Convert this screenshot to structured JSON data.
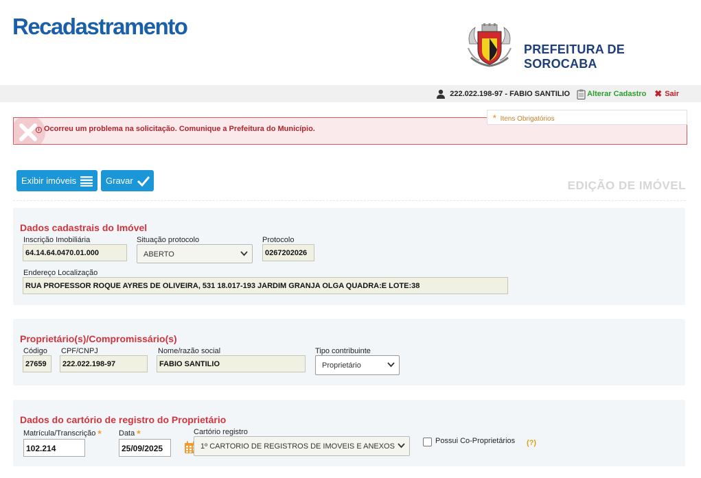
{
  "header": {
    "app_title": "Recadastramento",
    "city_name": "PREFEITURA DE SOROCABA"
  },
  "topbar": {
    "user": "222.022.198-97 - FABIO SANTILIO",
    "alter_label": "Alterar Cadastro",
    "exit_label": "Sair"
  },
  "required_note": "Itens Obrigatórios",
  "error": {
    "message": "Ocorreu um problema na solicitação. Comunique a Prefeitura do Município."
  },
  "toolbar": {
    "list_label": "Exibir imóveis",
    "save_label": "Gravar"
  },
  "page_title": "EDIÇÃO DE IMÓVEL",
  "property": {
    "title": "Dados cadastrais do Imóvel",
    "registration_label": "Inscrição Imobiliária",
    "registration_value": "64.14.64.0470.01.000",
    "status_label": "Situação protocolo",
    "status_value": "ABERTO",
    "protocol_label": "Protocolo",
    "protocol_value": "0267202026",
    "address_label": "Endereço Localização",
    "address_value": "RUA PROFESSOR ROQUE AYRES DE OLIVEIRA, 531 18.017-193 JARDIM GRANJA OLGA QUADRA:E LOTE:38"
  },
  "owner": {
    "title": "Proprietário(s)/Compromissário(s)",
    "code_label": "Código",
    "code_value": "27659",
    "doc_label": "CPF/CNPJ",
    "doc_value": "222.022.198-97",
    "name_label": "Nome/razão social",
    "name_value": "FABIO SANTILIO",
    "type_label": "Tipo contribuinte",
    "type_value": "Proprietário"
  },
  "registry": {
    "title": "Dados do cartório de registro do Proprietário",
    "matricula_label": "Matrícula/Transcrição",
    "matricula_value": "102.214",
    "date_label": "Data",
    "date_value": "25/09/2025",
    "office_label": "Cartório registro",
    "office_value": "1º CARTORIO DE REGISTROS DE IMOVEIS E ANEXOS",
    "coowner_label": "Possui Co-Proprietários",
    "help_label": "(?)"
  },
  "colors": {
    "brand_blue": "#1a5fa8",
    "button_blue": "#1b97d8",
    "section_red": "#d0343c",
    "error_border": "#d8575c",
    "link_green": "#2e9d2e"
  }
}
